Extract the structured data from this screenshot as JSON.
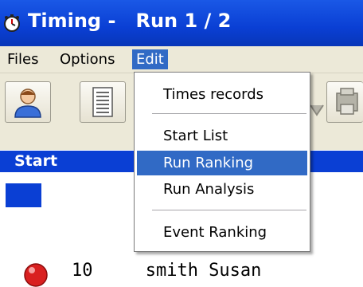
{
  "window": {
    "title": "Timing -   Run 1 / 2",
    "icon": "stopwatch-icon"
  },
  "menubar": {
    "items": [
      {
        "label": "Files"
      },
      {
        "label": "Options"
      },
      {
        "label": "Edit",
        "active": true
      }
    ]
  },
  "toolbar": {
    "buttons": [
      {
        "icon": "person-icon"
      },
      {
        "icon": "document-list-icon"
      }
    ]
  },
  "list_header": {
    "start_label": "Start"
  },
  "list": {
    "row_text": "10     smith Susan"
  },
  "edit_menu": {
    "items": [
      {
        "label": "Times records"
      },
      {
        "label": "Start List"
      },
      {
        "label": "Run Ranking",
        "highlighted": true
      },
      {
        "label": "Run Analysis"
      },
      {
        "label": "Event Ranking"
      }
    ]
  },
  "colors": {
    "title_blue": "#0a3fd4",
    "menu_highlight": "#316ac5",
    "chrome": "#ece9d8"
  }
}
